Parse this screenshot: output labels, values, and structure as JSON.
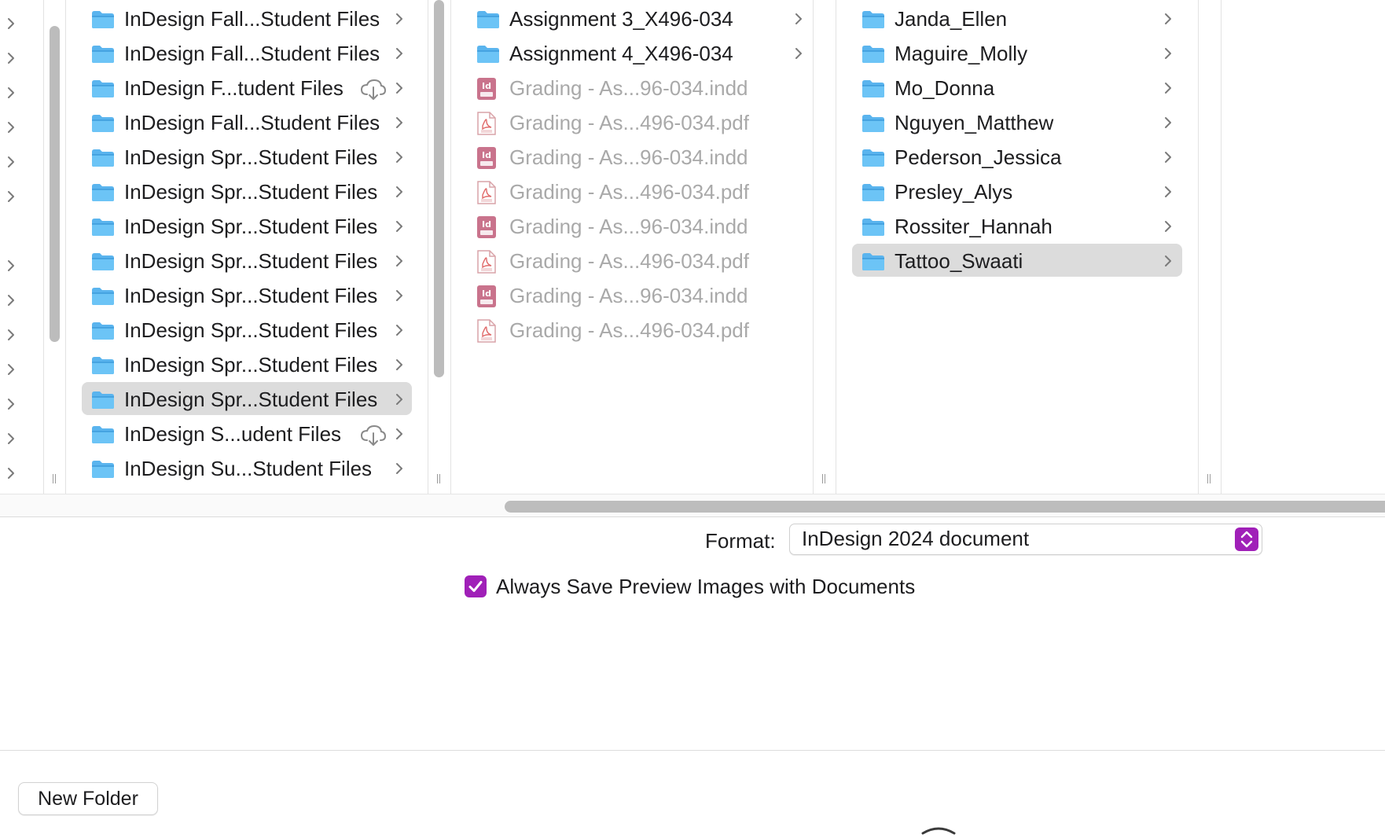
{
  "browser": {
    "column1": {
      "items": [
        {
          "label": "InDesign Fall...Student Files",
          "cloud": false,
          "selected": false
        },
        {
          "label": "InDesign Fall...Student Files",
          "cloud": false,
          "selected": false
        },
        {
          "label": "InDesign F...tudent Files",
          "cloud": true,
          "selected": false
        },
        {
          "label": "InDesign Fall...Student Files",
          "cloud": false,
          "selected": false
        },
        {
          "label": "InDesign Spr...Student Files",
          "cloud": false,
          "selected": false
        },
        {
          "label": "InDesign Spr...Student Files",
          "cloud": false,
          "selected": false
        },
        {
          "label": "InDesign Spr...Student Files",
          "cloud": false,
          "selected": false
        },
        {
          "label": "InDesign Spr...Student Files",
          "cloud": false,
          "selected": false
        },
        {
          "label": "InDesign Spr...Student Files",
          "cloud": false,
          "selected": false
        },
        {
          "label": "InDesign Spr...Student Files",
          "cloud": false,
          "selected": false
        },
        {
          "label": "InDesign Spr...Student Files",
          "cloud": false,
          "selected": false
        },
        {
          "label": "InDesign Spr...Student Files",
          "cloud": false,
          "selected": true
        },
        {
          "label": "InDesign S...udent Files",
          "cloud": true,
          "selected": false
        },
        {
          "label": "InDesign Su...Student Files",
          "cloud": false,
          "selected": false
        }
      ]
    },
    "column2": {
      "items": [
        {
          "label": "Assignment 3_X496-034",
          "kind": "folder"
        },
        {
          "label": "Assignment 4_X496-034",
          "kind": "folder"
        },
        {
          "label": "Grading - As...96-034.indd",
          "kind": "indd"
        },
        {
          "label": "Grading - As...496-034.pdf",
          "kind": "pdf"
        },
        {
          "label": "Grading - As...96-034.indd",
          "kind": "indd"
        },
        {
          "label": "Grading - As...496-034.pdf",
          "kind": "pdf"
        },
        {
          "label": "Grading - As...96-034.indd",
          "kind": "indd"
        },
        {
          "label": "Grading - As...496-034.pdf",
          "kind": "pdf"
        },
        {
          "label": "Grading - As...96-034.indd",
          "kind": "indd"
        },
        {
          "label": "Grading - As...496-034.pdf",
          "kind": "pdf"
        }
      ]
    },
    "column3": {
      "items": [
        {
          "label": "Janda_Ellen",
          "selected": false
        },
        {
          "label": "Maguire_Molly",
          "selected": false
        },
        {
          "label": "Mo_Donna",
          "selected": false
        },
        {
          "label": "Nguyen_Matthew",
          "selected": false
        },
        {
          "label": "Pederson_Jessica",
          "selected": false
        },
        {
          "label": "Presley_Alys",
          "selected": false
        },
        {
          "label": "Rossiter_Hannah",
          "selected": false
        },
        {
          "label": "Tattoo_Swaati",
          "selected": true
        }
      ]
    }
  },
  "options": {
    "format_label": "Format:",
    "format_value": "InDesign 2024 document",
    "preview_label": "Always Save Preview Images with Documents",
    "preview_checked": true
  },
  "footer": {
    "new_folder_label": "New Folder"
  },
  "icons": {
    "folder": "folder-icon",
    "indd": "indd-file-icon",
    "pdf": "pdf-file-icon",
    "cloud": "cloud-download-icon",
    "chevron": "chevron-right-icon",
    "stepper": "up-down-chevron-icon",
    "checkmark": "checkmark-icon"
  },
  "colors": {
    "accent": "#a020b8",
    "folder": "#5ab4ee",
    "selection": "#dcdcdc",
    "dim_text": "#a9a9a9"
  }
}
